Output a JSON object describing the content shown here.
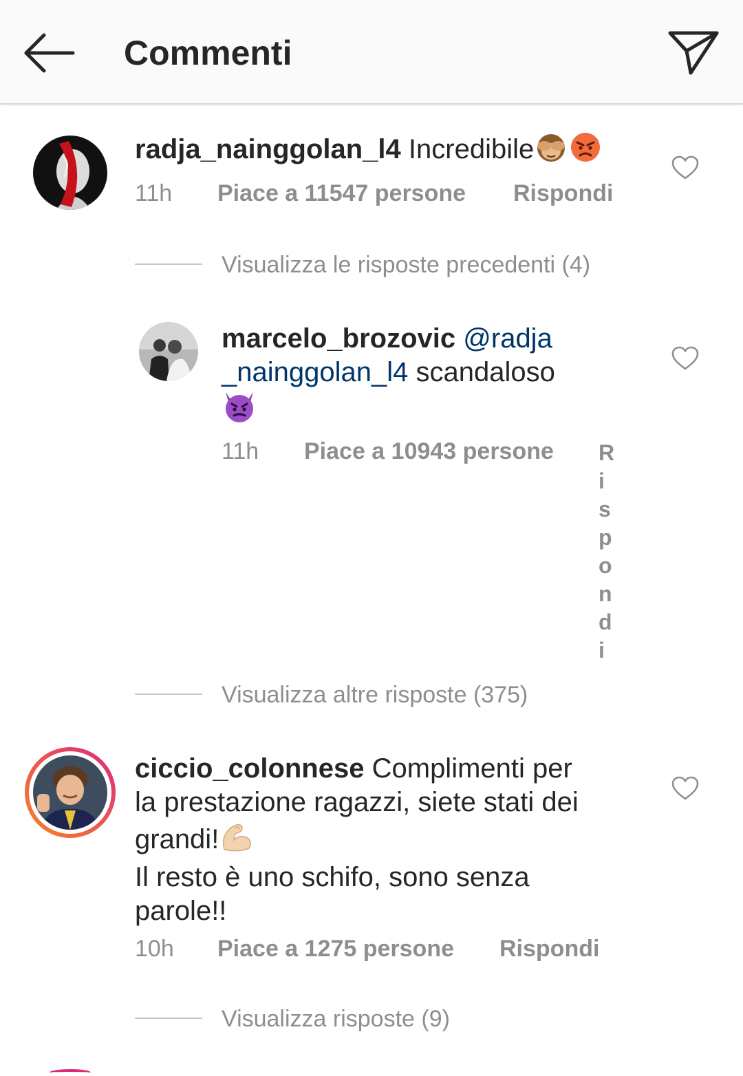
{
  "header": {
    "title": "Commenti"
  },
  "comments": [
    {
      "username": "radja_nainggolan_l4",
      "text": "Incredibile",
      "time": "11h",
      "likes": "Piace a 11547 persone",
      "reply": "Rispondi",
      "thread_link": "Visualizza le risposte precedenti (4)"
    },
    {
      "username": "marcelo_brozovic",
      "mention": "@radja _nainggolan_l4",
      "text": "scandaloso",
      "time": "11h",
      "likes": "Piace a 10943 persone",
      "reply": "Rispondi",
      "thread_link": "Visualizza altre risposte (375)"
    },
    {
      "username": "ciccio_colonnese",
      "text_line1": "Complimenti per",
      "text_line2": "la prestazione ragazzi, siete stati dei",
      "text_line3": "grandi!",
      "text_line4": "Il resto è uno schifo, sono senza",
      "text_line5": "parole!!",
      "time": "10h",
      "likes": "Piace a 1275 persone",
      "reply": "Rispondi",
      "thread_link": "Visualizza risposte (9)"
    }
  ],
  "icons": {
    "back": "arrow-left-icon",
    "send": "paper-plane-icon",
    "like": "heart-outline-icon"
  },
  "colors": {
    "text": "#262626",
    "meta": "#8e8e8e",
    "mention": "#003569",
    "header_bg": "#fafafa",
    "story_ring_start": "#f58529",
    "story_ring_end": "#dd2a7b"
  }
}
